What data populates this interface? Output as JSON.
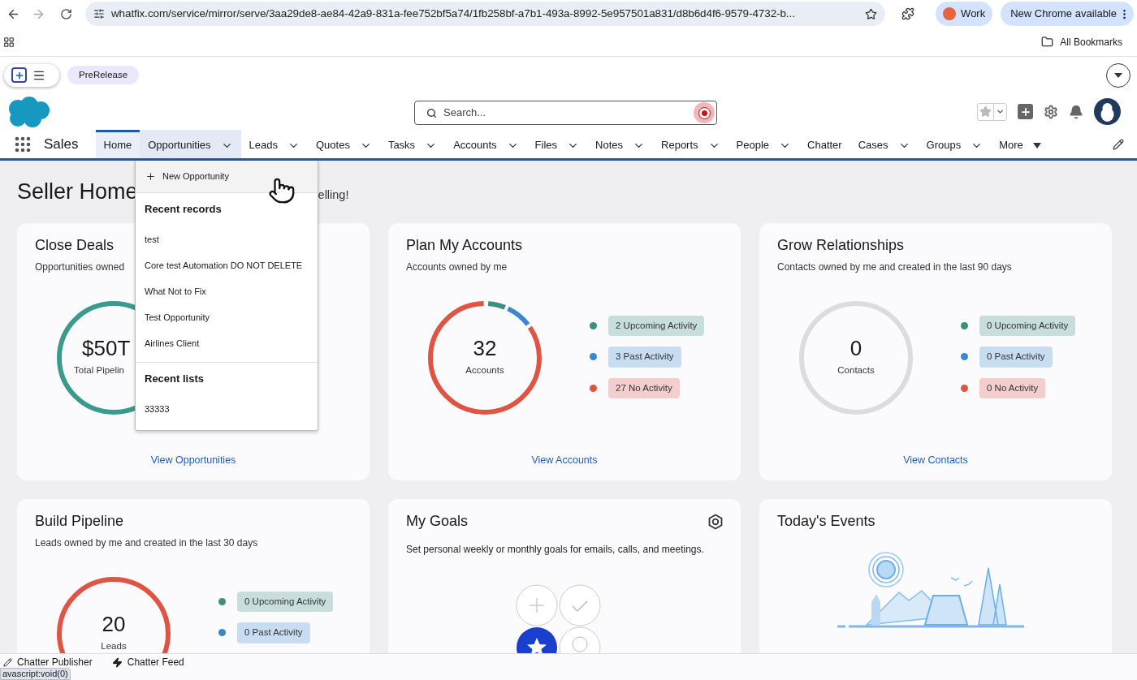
{
  "browser": {
    "url": "whatfix.com/service/mirror/serve/3aa29de8-ae84-42a9-831a-fee752bf5a74/1fb258bf-a7b1-493a-8992-5e957501a831/d8b6d4f6-9579-4732-b...",
    "profile": "Work",
    "update": "New Chrome available",
    "bookmarks": "All Bookmarks"
  },
  "whatfix": {
    "badge": "PreRelease"
  },
  "header": {
    "search_placeholder": "Search..."
  },
  "nav": {
    "app": "Sales",
    "items": [
      {
        "label": "Home",
        "kind": "link",
        "selected": true,
        "expanded": false
      },
      {
        "label": "Opportunities",
        "kind": "menu",
        "selected": false,
        "expanded": true
      },
      {
        "label": "Leads",
        "kind": "menu",
        "selected": false,
        "expanded": false
      },
      {
        "label": "Quotes",
        "kind": "menu",
        "selected": false,
        "expanded": false
      },
      {
        "label": "Tasks",
        "kind": "menu",
        "selected": false,
        "expanded": false
      },
      {
        "label": "Accounts",
        "kind": "menu",
        "selected": false,
        "expanded": false
      },
      {
        "label": "Files",
        "kind": "menu",
        "selected": false,
        "expanded": false
      },
      {
        "label": "Notes",
        "kind": "menu",
        "selected": false,
        "expanded": false
      },
      {
        "label": "Reports",
        "kind": "menu",
        "selected": false,
        "expanded": false
      },
      {
        "label": "People",
        "kind": "menu",
        "selected": false,
        "expanded": false
      },
      {
        "label": "Chatter",
        "kind": "link",
        "selected": false,
        "expanded": false
      },
      {
        "label": "Cases",
        "kind": "menu",
        "selected": false,
        "expanded": false
      },
      {
        "label": "Groups",
        "kind": "menu",
        "selected": false,
        "expanded": false
      },
      {
        "label": "More",
        "kind": "more",
        "selected": false,
        "expanded": false
      }
    ]
  },
  "menu": {
    "action": "New Opportunity",
    "sections": [
      {
        "title": "Recent records",
        "items": [
          "test",
          "Core test Automation DO NOT DELETE",
          "What Not to Fix",
          "Test Opportunity",
          "Airlines Client"
        ]
      },
      {
        "title": "Recent lists",
        "items": [
          "33333"
        ]
      }
    ]
  },
  "page": {
    "title": "Seller Home",
    "title_tail": "elling!"
  },
  "cards": [
    {
      "kind": "ring",
      "title": "Close Deals",
      "subtitle": "Opportunities owned",
      "value": "$50T",
      "caption": "Total Pipelin",
      "ring": {
        "kind": "partial"
      },
      "link": "View Opportunities"
    },
    {
      "kind": "ring",
      "title": "Plan My Accounts",
      "subtitle": "Accounts owned by me",
      "value": "32",
      "caption": "Accounts",
      "link": "View Accounts",
      "ring": {
        "kind": "segmented"
      },
      "legend": [
        {
          "text": "2 Upcoming Activity",
          "color": "#3a8f80"
        },
        {
          "text": "3 Past Activity",
          "color": "#3b86d1"
        },
        {
          "text": "27 No Activity",
          "color": "#e05444"
        }
      ]
    },
    {
      "kind": "ring",
      "title": "Grow Relationships",
      "subtitle": "Contacts owned by me and created in the last 90 days",
      "value": "0",
      "caption": "Contacts",
      "link": "View Contacts",
      "ring": {
        "kind": "empty"
      },
      "legend": [
        {
          "text": "0 Upcoming Activity",
          "color": "#3a8f80"
        },
        {
          "text": "0 Past Activity",
          "color": "#3b86d1"
        },
        {
          "text": "0 No Activity",
          "color": "#e05444"
        }
      ]
    },
    {
      "kind": "ring",
      "title": "Build Pipeline",
      "subtitle": "Leads owned by me and created in the last 30 days",
      "value": "20",
      "caption": "Leads",
      "ring": {
        "kind": "full"
      },
      "legend": [
        {
          "text": "0 Upcoming Activity",
          "color": "#3a8f80"
        },
        {
          "text": "0 Past Activity",
          "color": "#3b86d1"
        }
      ]
    },
    {
      "kind": "goals",
      "title": "My Goals",
      "subtitle": "Set personal weekly or monthly goals for emails, calls, and meetings."
    },
    {
      "kind": "events",
      "title": "Today's Events"
    }
  ],
  "footer": {
    "items": [
      "Chatter Publisher",
      "Chatter Feed"
    ],
    "status": "avascript:void(0)"
  }
}
